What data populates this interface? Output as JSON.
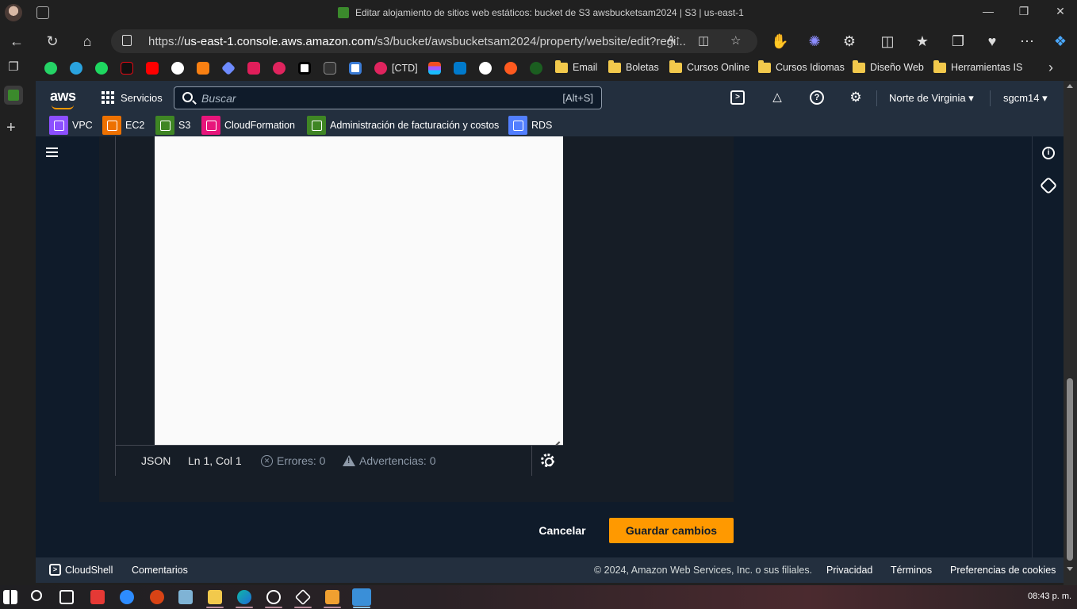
{
  "browser": {
    "window_title": "Editar alojamiento de sitios web estáticos: bucket de S3 awsbucketsam2024 | S3 | us-east-1",
    "url_prefix": "https://",
    "url_host": "us-east-1.console.aws.amazon.com",
    "url_path": "/s3/bucket/awsbucketsam2024/property/website/edit?regi...",
    "bookmarks_icons": [
      "whatsapp-icon",
      "telegram-icon",
      "spotify-icon",
      "netflix-icon",
      "youtube-icon",
      "chatgpt-icon",
      "moodle-icon",
      "gemini-icon",
      "slack-icon",
      "1k-icon",
      "dev-icon",
      "dashboard-icon",
      "notion-icon"
    ],
    "bookmark_ctd": "[CTD]",
    "bookmark_folders": [
      "Email",
      "Boletas",
      "Cursos Online",
      "Cursos Idiomas",
      "Diseño Web",
      "Herramientas IS"
    ]
  },
  "aws_header": {
    "logo": "aws",
    "services_label": "Servicios",
    "search_placeholder": "Buscar",
    "search_shortcut": "[Alt+S]",
    "region": "Norte de Virginia",
    "user": "sgcm14",
    "favorites": [
      {
        "label": "VPC",
        "color": "#8c4fff"
      },
      {
        "label": "EC2",
        "color": "#ed7100"
      },
      {
        "label": "S3",
        "color": "#3f8624"
      },
      {
        "label": "CloudFormation",
        "color": "#e7157b"
      },
      {
        "label": "Administración de facturación y costos",
        "color": "#3f8624"
      },
      {
        "label": "RDS",
        "color": "#527fff"
      }
    ]
  },
  "editor": {
    "language": "JSON",
    "cursor": "Ln 1, Col 1",
    "errors": "Errores: 0",
    "warnings": "Advertencias: 0"
  },
  "actions": {
    "cancel": "Cancelar",
    "save": "Guardar cambios"
  },
  "footer": {
    "cloudshell": "CloudShell",
    "comments": "Comentarios",
    "copyright": "© 2024, Amazon Web Services, Inc. o sus filiales.",
    "privacy": "Privacidad",
    "terms": "Términos",
    "cookies": "Preferencias de cookies"
  },
  "taskbar": {
    "time": "08:43 p. m."
  },
  "colors": {
    "accent": "#ff9900",
    "header_bg": "#232f3e",
    "content_bg": "#0f1b2a"
  }
}
